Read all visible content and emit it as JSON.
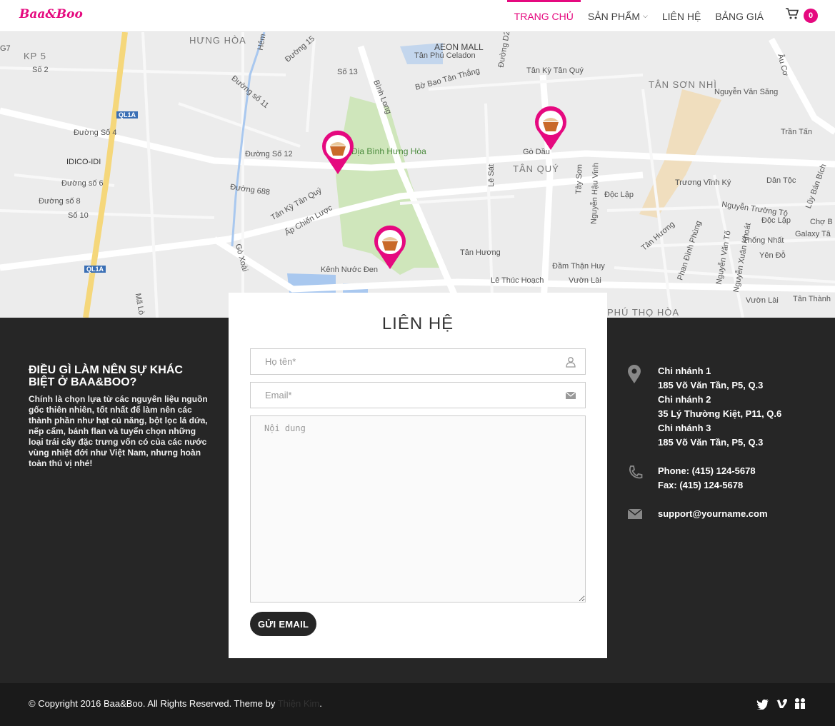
{
  "brand": {
    "logo": "Baa&Boo",
    "accent_color": "#e5097f"
  },
  "nav": {
    "items": [
      {
        "label": "TRANG CHỦ"
      },
      {
        "label": "SẢN PHẨM"
      },
      {
        "label": "LIÊN HỆ"
      },
      {
        "label": "BẢNG GIÁ"
      }
    ],
    "cart_count": "0"
  },
  "map": {
    "labels": [
      "KP 5",
      "HƯNG HÒA",
      "AEON MALL",
      "Tân Phú Celadon",
      "TÂN SƠN NHÌ",
      "Bình Long",
      "Đường Số 12",
      "Gò Dầu",
      "TÂN QUÝ",
      "IDICO-IDI",
      "Đường số 6",
      "Đường số 8",
      "Số 10",
      "Đường Số 4",
      "Địa Bình Hưng Hòa",
      "Tân Kỳ Tân Quý",
      "Ấp Chiến Lược",
      "Kênh Nước Đen",
      "Tân Hương",
      "Đầm Thận Huy",
      "Lê Thúc Hoạch",
      "Vườn Lài",
      "Độc Lập",
      "Trương Vĩnh Ký",
      "Nguyễn Văn Săng",
      "Dân Tộc",
      "Thống Nhất",
      "Yên Đỗ",
      "Galaxy Tâ",
      "Chợ B",
      "PHÚ THỌ HÒA",
      "Tân Thành",
      "Đường 688",
      "Gò Xoài",
      "Trần Tấn",
      "Lũy Bán Bích",
      "Nguyễn Trường Tộ",
      "Độc Lập",
      "Phan Đình Phùng",
      "Nguyễn Văn Tố",
      "Nguyễn Xuân Khoát",
      "Tây Sơn",
      "Nguyễn Hậu Vinh",
      "Lê Sát",
      "Bờ Bao Tân Thắng",
      "Tân Kỳ Tân Quý",
      "Đường D2",
      "Hẻm",
      "Đường 15",
      "Số 13",
      "Đường số 11",
      "Số 2",
      "G7",
      "Âu Cơ",
      "Tân Hương",
      "Vườn Lài",
      "QL1A",
      "QL1A",
      "Mã Lò"
    ]
  },
  "contact_form": {
    "title": "LIÊN HỆ",
    "name_placeholder": "Họ tên*",
    "email_placeholder": "Email*",
    "message_placeholder": "Nội dung",
    "send_label": "GỬI EMAIL"
  },
  "about": {
    "heading": "ĐIỀU GÌ LÀM NÊN SỰ KHÁC BIỆT Ở BAA&BOO?",
    "body": "Chính là chọn lựa từ các nguyên liệu nguồn gốc thiên nhiên, tốt nhất để làm nên các thành phần như hạt củ năng, bột lọc lá dứa, nếp cẩm, bánh flan và tuyển chọn những loại trái cây đặc trưng vốn có của các nước vùng nhiệt đới như Việt Nam, nhưng hoàn toàn thú vị nhé!"
  },
  "branches": [
    {
      "name": "Chi nhánh 1",
      "address": "185 Võ Văn Tần, P5, Q.3"
    },
    {
      "name": "Chi nhánh 2",
      "address": "35 Lý Thường Kiệt, P11, Q.6"
    },
    {
      "name": "Chi nhánh 3",
      "address": "185 Võ Văn Tần, P5, Q.3"
    }
  ],
  "phones": {
    "phone": "Phone: (415) 124-5678",
    "fax": "Fax: (415) 124-5678"
  },
  "email": "support@yourname.com",
  "footer": {
    "copyright": "© Copyright 2016 Baa&Boo. All Rights Reserved. Theme by ",
    "theme_author": "Thiện Kim",
    "period": "."
  }
}
